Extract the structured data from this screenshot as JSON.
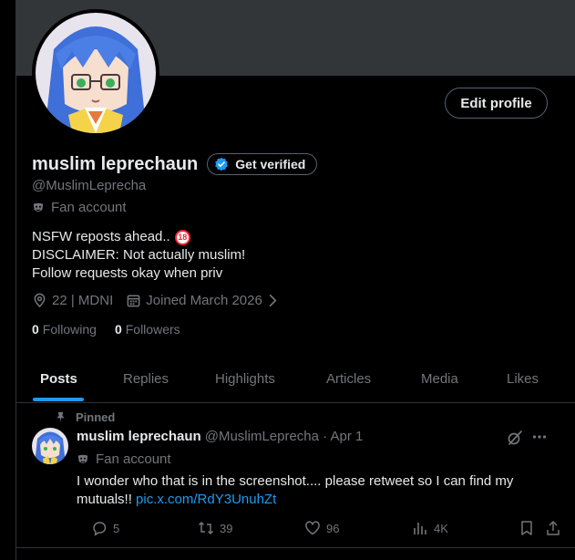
{
  "profile": {
    "display_name": "muslim leprechaun",
    "verify_label": "Get verified",
    "handle": "@MuslimLeprecha",
    "account_type": "Fan account",
    "bio_lines": [
      "NSFW reposts ahead..",
      "DISCLAIMER: Not actually muslim!",
      "Follow requests okay when priv"
    ],
    "bio_badge": "18",
    "location": "22 | MDNI",
    "joined": "Joined March 2026",
    "following_count": "0",
    "following_label": "Following",
    "followers_count": "0",
    "followers_label": "Followers",
    "edit_label": "Edit profile"
  },
  "tabs": [
    {
      "label": "Posts",
      "active": true
    },
    {
      "label": "Replies"
    },
    {
      "label": "Highlights"
    },
    {
      "label": "Articles"
    },
    {
      "label": "Media"
    },
    {
      "label": "Likes"
    }
  ],
  "post": {
    "pinned_label": "Pinned",
    "name": "muslim leprechaun",
    "handle_date": "@MuslimLeprecha · Apr 1",
    "account_type": "Fan account",
    "text": "I wonder who that is in the screenshot.... please retweet so I can find my mutuals!!",
    "link": "pic.x.com/RdY3UnuhZt",
    "replies": "5",
    "reposts": "39",
    "likes": "96",
    "views": "4K"
  },
  "colors": {
    "background": "#000000",
    "banner": "#333639",
    "accent": "#1d9bf0",
    "muted_text": "#71767b",
    "primary_text": "#e7e9ea",
    "border": "#2f3336"
  },
  "icons": [
    "mask-icon",
    "location-icon",
    "calendar-icon",
    "chevron-right-icon",
    "verified-badge-icon",
    "pin-icon",
    "grok-icon",
    "more-icon",
    "reply-icon",
    "repost-icon",
    "like-icon",
    "views-icon",
    "bookmark-icon",
    "share-icon"
  ]
}
